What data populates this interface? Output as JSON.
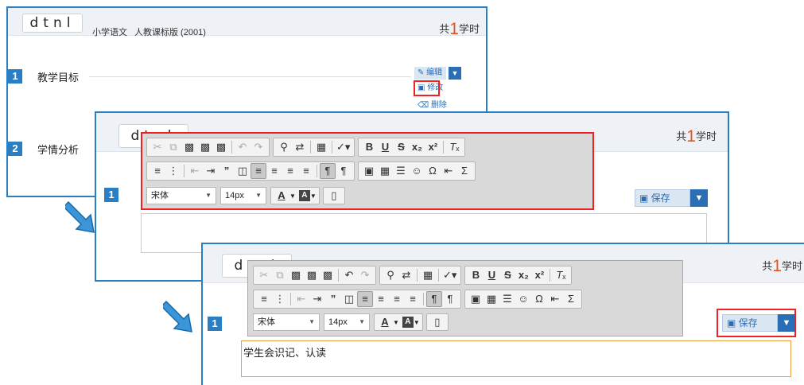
{
  "header": {
    "logo": "dtnl",
    "subject": "小学语文",
    "edition": "人教课标版 (2001)",
    "hours_prefix": "共",
    "hours_value": "1",
    "hours_suffix": "学时"
  },
  "sections": [
    {
      "number": "1",
      "title": "教学目标"
    },
    {
      "number": "2",
      "title": "学情分析"
    }
  ],
  "action_menu": {
    "edit": "编辑",
    "modify": "修改",
    "delete": "删除"
  },
  "save_button": {
    "label": "保存"
  },
  "toolbar": {
    "font_family": "宋体",
    "font_size": "14px",
    "font_color": "A",
    "bg_color": "A"
  },
  "editor": {
    "content": "学生会识记、认读"
  },
  "colors": {
    "accent": "#2a7ec4",
    "highlight": "#e22222",
    "hours_number": "#e8531b"
  }
}
